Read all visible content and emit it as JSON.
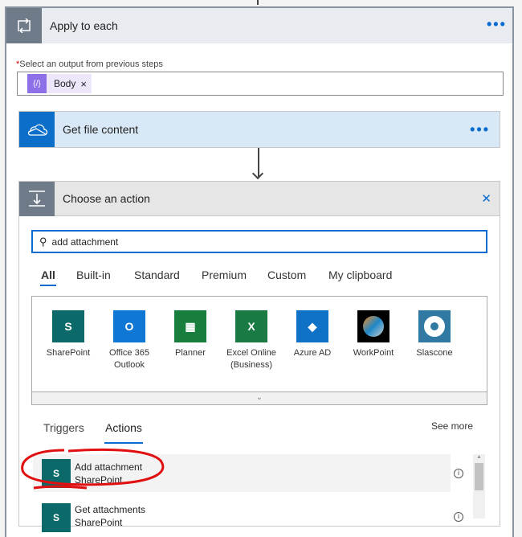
{
  "apply_each": {
    "title": "Apply to each",
    "more": "•••",
    "field_label": "Select an output from previous steps",
    "required_mark": "*",
    "token": "Body",
    "token_remove": "×"
  },
  "get_file": {
    "title": "Get file content",
    "more": "•••"
  },
  "choose": {
    "title": "Choose an action",
    "close": "✕",
    "search_value": "add attachment",
    "tabs": [
      "All",
      "Built-in",
      "Standard",
      "Premium",
      "Custom",
      "My clipboard"
    ],
    "connectors": [
      {
        "name": "SharePoint",
        "color": "#0b6a69"
      },
      {
        "name": "Office 365 Outlook",
        "color": "#0f78d4"
      },
      {
        "name": "Planner",
        "color": "#177e3e"
      },
      {
        "name": "Excel Online (Business)",
        "color": "#197b43"
      },
      {
        "name": "Azure AD",
        "color": "#0f72c6"
      },
      {
        "name": "WorkPoint",
        "color": "#000000"
      },
      {
        "name": "Slascone",
        "color": "#2f79a3"
      }
    ],
    "subtabs": [
      "Triggers",
      "Actions"
    ],
    "see_more": "See more",
    "actions": [
      {
        "title": "Add attachment",
        "connector": "SharePoint"
      },
      {
        "title": "Get attachments",
        "connector": "SharePoint"
      }
    ]
  }
}
